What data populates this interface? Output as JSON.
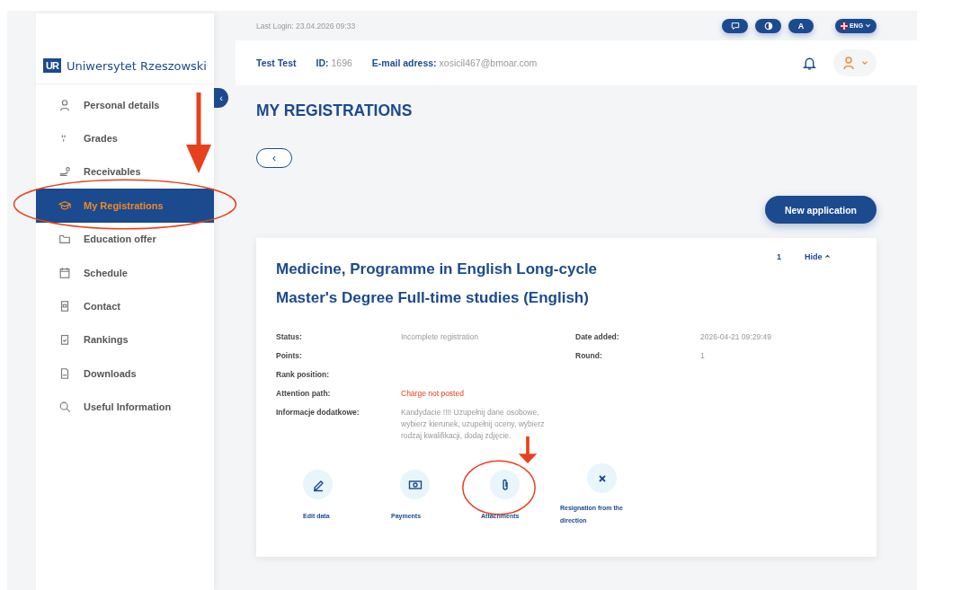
{
  "sidebar": {
    "logo_mark": "UR",
    "logo_text": "Uniwersytet Rzeszowski",
    "items": [
      {
        "label": "Personal details",
        "selected": false
      },
      {
        "label": "Grades",
        "selected": false
      },
      {
        "label": "Receivables",
        "selected": false
      },
      {
        "label": "My Registrations",
        "selected": true
      },
      {
        "label": "Education offer",
        "selected": false
      },
      {
        "label": "Schedule",
        "selected": false
      },
      {
        "label": "Contact",
        "selected": false
      },
      {
        "label": "Rankings",
        "selected": false
      },
      {
        "label": "Downloads",
        "selected": false
      },
      {
        "label": "Useful Information",
        "selected": false
      }
    ],
    "collapse_button": "‹"
  },
  "top_bar": {
    "last_login_label": "Last Login:",
    "last_login_value": "23.04.2026 09:33",
    "font_button": "A",
    "language": "ENG"
  },
  "header": {
    "name": "Test Test",
    "id_label": "ID:",
    "id_value": "1696",
    "email_label": "E-mail adress:",
    "email_value": "xosicil467@bmoar.com"
  },
  "page_title": "MY REGISTRATIONS",
  "back_button": "‹",
  "new_application_button": "New application",
  "registration": {
    "title_lines": [
      "Medicine, Programme in English Long-cycle",
      "Master's Degree Full-time studies (English)"
    ],
    "number": "1",
    "hide_link": "Hide",
    "left_fields": [
      {
        "label": "Status:",
        "value": "Incomplete registration",
        "kind": "plain"
      },
      {
        "label": "Points:",
        "kind": "plain"
      },
      {
        "label": "Rank position:",
        "kind": "plain"
      },
      {
        "label": "Attention path:",
        "value": "Charge not posted",
        "kind": "alert"
      },
      {
        "label": "Informacje dodatkowe:",
        "value": "Kandydacie !!!! Uzupełnij dane osobowe, wybierz kierunek, uzupełnij oceny, wybierz rodzaj kwalifikacji, dodaj zdjęcie.",
        "kind": "plain"
      }
    ],
    "right_fields": [
      {
        "label": "Date added:",
        "value": "2026-04-21 09:29:49"
      },
      {
        "label": "Round:",
        "value": "1"
      }
    ],
    "actions": [
      {
        "label": "Edit data"
      },
      {
        "label": "Payments"
      },
      {
        "label": "Attachments"
      },
      {
        "label": "Resignation from the direction"
      }
    ]
  },
  "annotations": [
    {
      "kind": "arrow"
    },
    {
      "kind": "ellipse"
    },
    {
      "kind": "arrow"
    },
    {
      "kind": "ellipse"
    }
  ]
}
